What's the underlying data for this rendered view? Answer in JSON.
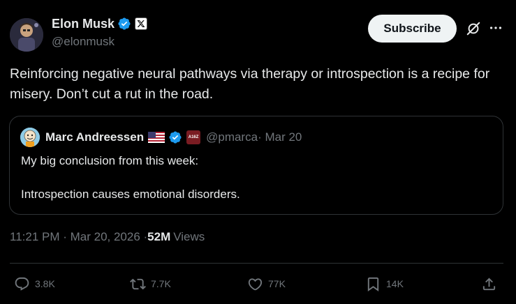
{
  "author": {
    "name": "Elon Musk",
    "handle": "@elonmusk"
  },
  "header": {
    "subscribe_label": "Subscribe"
  },
  "tweet": {
    "text": "Reinforcing negative neural pathways via therapy or introspection is a recipe for misery. Don’t cut a rut in the road."
  },
  "quote": {
    "name": "Marc Andreessen",
    "handle": "@pmarca",
    "date": " · Mar 20",
    "badge_text": "A16Z",
    "text": "My big conclusion from this week:\n\nIntrospection causes emotional disorders."
  },
  "meta": {
    "time": "11:21 PM · Mar 20, 2026 · ",
    "views_count": "52M",
    "views_label": "Views"
  },
  "actions": {
    "replies": "3.8K",
    "reposts": "7.7K",
    "likes": "77K",
    "bookmarks": "14K"
  },
  "colors": {
    "background": "#000000",
    "text": "#e7e9ea",
    "muted": "#71767b",
    "verified": "#1d9bf0",
    "border": "#2f3336"
  },
  "icons": [
    "verified-badge-icon",
    "x-affiliate-icon",
    "grok-icon",
    "more-icon",
    "flag-us-icon",
    "reply-icon",
    "repost-icon",
    "like-icon",
    "bookmark-icon",
    "share-icon"
  ]
}
